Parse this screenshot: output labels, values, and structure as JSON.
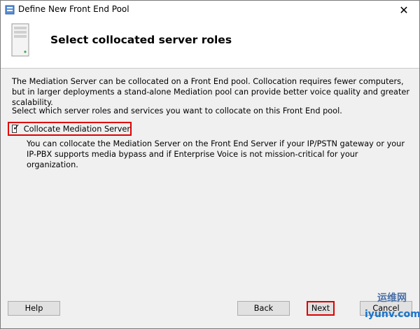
{
  "window": {
    "title": "Define New Front End Pool"
  },
  "header": {
    "title": "Select collocated server roles"
  },
  "content": {
    "paragraph1": "The Mediation Server can be collocated on a Front End pool. Collocation requires fewer computers, but in larger deployments a stand-alone Mediation pool can provide better voice quality and greater scalability.",
    "paragraph2": "Select which server roles and services you want to collocate on this Front End pool.",
    "checkbox": {
      "label": "Collocate Mediation Server",
      "checked": true
    },
    "description": "You can collocate the Mediation Server on the Front End Server if your IP/PSTN gateway or your IP-PBX supports media bypass and if Enterprise Voice is not mission-critical for your organization."
  },
  "footer": {
    "help_label": "Help",
    "back_label": "Back",
    "next_label": "Next",
    "cancel_label": "Cancel"
  },
  "watermark": {
    "cn": "运维网",
    "url": "iyunv.com"
  },
  "icons": {
    "app": "app-icon",
    "server": "server-icon",
    "close": "close-icon"
  },
  "colors": {
    "highlight": "#e00000",
    "content_bg": "#f0f0f0",
    "button_bg": "#e1e1e1"
  }
}
